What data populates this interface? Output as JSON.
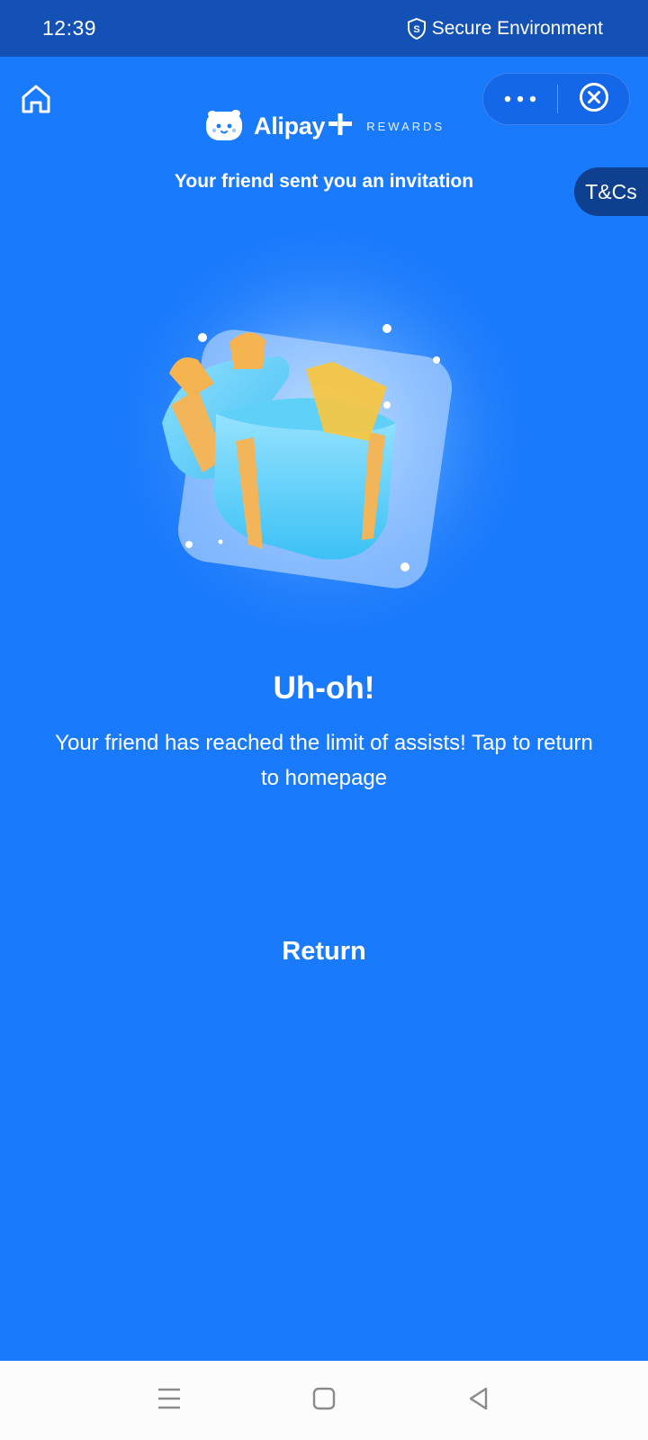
{
  "status_bar": {
    "time": "12:39",
    "secure_label": "Secure Environment"
  },
  "header": {
    "brand_name": "Alipay",
    "brand_tag": "REWARDS",
    "invite_text": "Your friend sent you an invitation",
    "tncs_label": "T&Cs"
  },
  "main": {
    "headline": "Uh-oh!",
    "message": "Your friend has reached the limit of assists! Tap to return to homepage",
    "return_label": "Return"
  },
  "icons": {
    "home": "home-icon",
    "more": "more-horizontal-icon",
    "close": "close-circle-icon",
    "shield": "shield-icon",
    "nav_menu": "menu-icon",
    "nav_home": "square-icon",
    "nav_back": "back-triangle-icon"
  },
  "colors": {
    "background": "#1a7afc",
    "status_bar": "#1351b4",
    "tncs_bg": "#0f3f8f",
    "nav_bar": "#fcfcfc"
  }
}
